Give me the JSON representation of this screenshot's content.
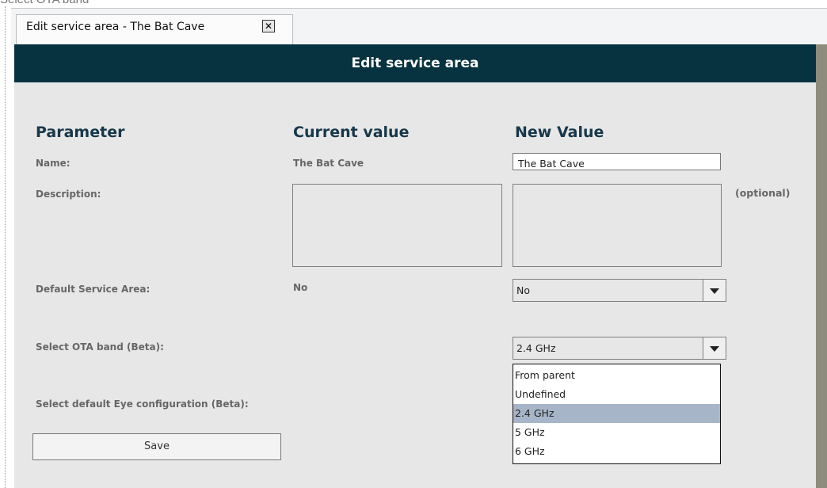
{
  "top_caption": "Select OTA band",
  "tab": {
    "label": "Edit service area - The Bat Cave",
    "close_icon": "close-icon"
  },
  "header": {
    "title": "Edit service area"
  },
  "columns": {
    "parameter": "Parameter",
    "current": "Current value",
    "new": "New Value"
  },
  "rows": {
    "name": {
      "label": "Name:",
      "current": "The Bat Cave",
      "new_value": "The Bat Cave"
    },
    "description": {
      "label": "Description:",
      "optional": "(optional)"
    },
    "default_area": {
      "label": "Default Service Area:",
      "current": "No",
      "selected": "No"
    },
    "ota_band": {
      "label": "Select OTA band (Beta):",
      "selected": "2.4 GHz",
      "options": [
        "From parent",
        "Undefined",
        "2.4 GHz",
        "5 GHz",
        "6 GHz"
      ]
    },
    "eye_config": {
      "label": "Select default Eye configuration (Beta):"
    }
  },
  "save_label": "Save"
}
